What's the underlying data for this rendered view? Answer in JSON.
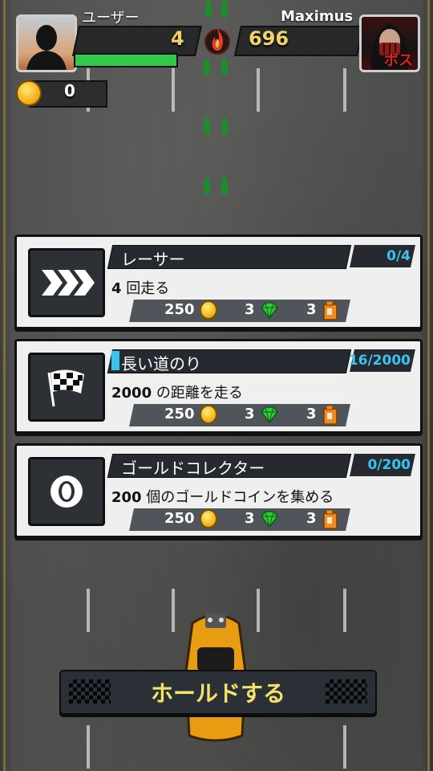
{
  "player": {
    "name": "ユーザー",
    "score": "4",
    "coins": "0",
    "health_fraction": 0.9
  },
  "boss": {
    "name": "Maximus",
    "score": "696",
    "tag": "ボス"
  },
  "missions": [
    {
      "title": "レーサー",
      "progress": "0/4",
      "desc_num": "4",
      "desc_text": " 回走る",
      "progress_fraction": 0.0,
      "reward_coins": "250",
      "reward_gems": "3",
      "reward_fuel": "3",
      "icon": "chevrons-icon"
    },
    {
      "title": "長い道のり",
      "progress": "16/2000",
      "desc_num": "2000",
      "desc_text": " の距離を走る",
      "progress_fraction": 0.008,
      "reward_coins": "250",
      "reward_gems": "3",
      "reward_fuel": "3",
      "icon": "checkered-flag-icon"
    },
    {
      "title": "ゴールドコレクター",
      "progress": "0/200",
      "desc_num": "200",
      "desc_text": " 個のゴールドコインを集める",
      "progress_fraction": 0.0,
      "reward_coins": "250",
      "reward_gems": "3",
      "reward_fuel": "3",
      "icon": "coin-ring-icon"
    }
  ],
  "hold_button": {
    "label": "ホールドする"
  },
  "colors": {
    "accent_blue": "#39c4f0",
    "gold": "#f3d16a",
    "health_green": "#33c84b",
    "hold_text": "#f3e36a"
  }
}
